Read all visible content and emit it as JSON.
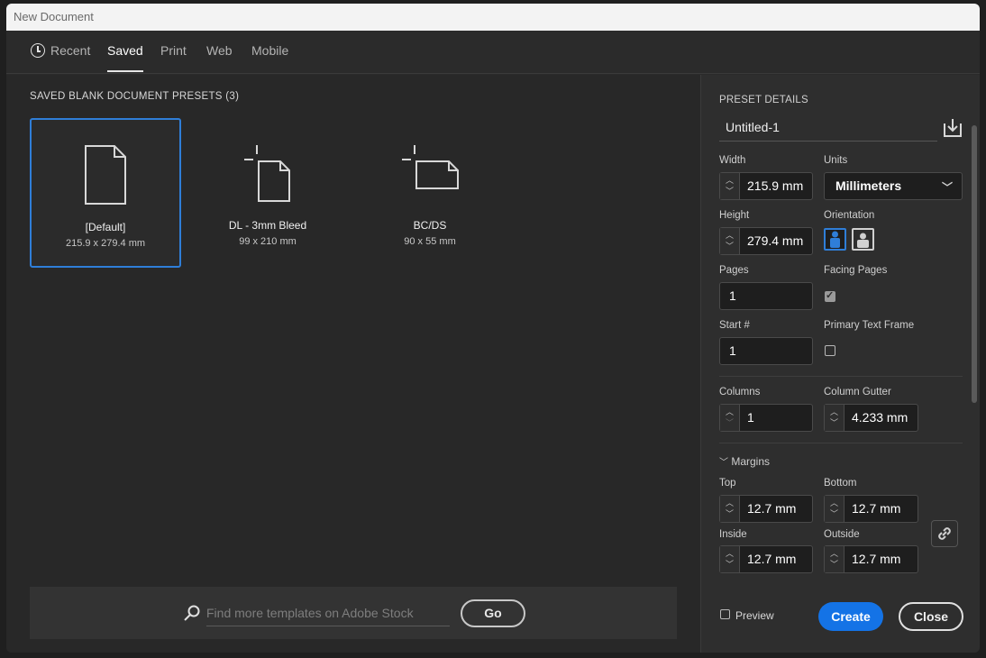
{
  "window": {
    "title": "New Document"
  },
  "tabs": [
    {
      "label": "Recent",
      "icon": "clock-icon"
    },
    {
      "label": "Saved",
      "active": true
    },
    {
      "label": "Print"
    },
    {
      "label": "Web"
    },
    {
      "label": "Mobile"
    }
  ],
  "presets": {
    "section_title": "SAVED BLANK DOCUMENT PRESETS",
    "count": "(3)",
    "items": [
      {
        "name": "[Default]",
        "size": "215.9 x 279.4 mm",
        "selected": true
      },
      {
        "name": "DL - 3mm Bleed",
        "size": "99 x 210 mm"
      },
      {
        "name": "BC/DS",
        "size": "90 x 55 mm"
      }
    ]
  },
  "stock": {
    "placeholder": "Find more templates on Adobe Stock",
    "go_label": "Go"
  },
  "details": {
    "title": "PRESET DETAILS",
    "name": "Untitled-1",
    "width_label": "Width",
    "width": "215.9 mm",
    "units_label": "Units",
    "units": "Millimeters",
    "height_label": "Height",
    "height": "279.4 mm",
    "orientation_label": "Orientation",
    "pages_label": "Pages",
    "pages": "1",
    "facing_label": "Facing Pages",
    "facing_checked": true,
    "start_label": "Start #",
    "start": "1",
    "primary_label": "Primary Text Frame",
    "primary_checked": false,
    "columns_label": "Columns",
    "columns": "1",
    "gutter_label": "Column Gutter",
    "gutter": "4.233 mm",
    "margins_label": "Margins",
    "top_label": "Top",
    "top": "12.7 mm",
    "bottom_label": "Bottom",
    "bottom": "12.7 mm",
    "inside_label": "Inside",
    "inside": "12.7 mm",
    "outside_label": "Outside",
    "outside": "12.7 mm"
  },
  "footer": {
    "preview_label": "Preview",
    "create_label": "Create",
    "close_label": "Close"
  },
  "colors": {
    "accent": "#1473e6",
    "selection": "#2f7ed8"
  }
}
